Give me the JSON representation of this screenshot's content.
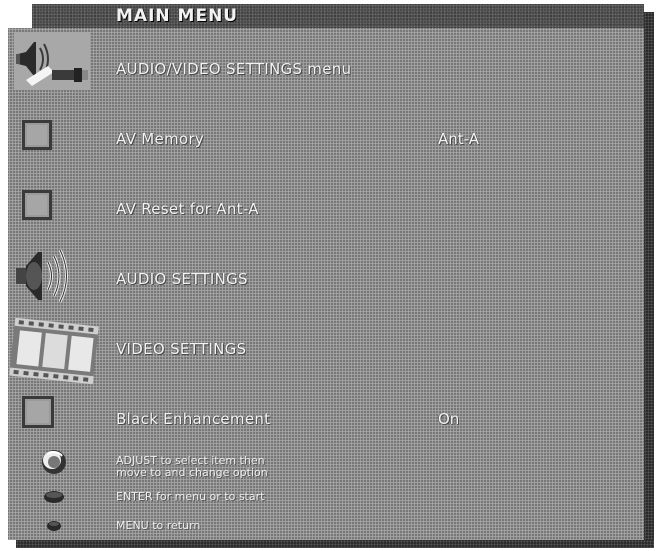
{
  "menu": {
    "title": "MAIN MENU",
    "items": [
      {
        "label": "AUDIO/VIDEO SETTINGS menu",
        "value": "",
        "icon": "av-settings-icon"
      },
      {
        "label": "AV Memory",
        "value": "Ant-A",
        "icon": "checkbox-icon"
      },
      {
        "label": "AV Reset for Ant-A",
        "value": "",
        "icon": "checkbox-icon"
      },
      {
        "label": "AUDIO SETTINGS",
        "value": "",
        "icon": "speaker-icon"
      },
      {
        "label": "VIDEO SETTINGS",
        "value": "",
        "icon": "film-icon"
      },
      {
        "label": "Black Enhancement",
        "value": "On",
        "icon": "checkbox-icon"
      }
    ]
  },
  "help": {
    "adjust_line1": "ADJUST to select item then",
    "adjust_line2": "move to and change option",
    "enter": "ENTER for menu or to start",
    "menu": "MENU to return"
  },
  "colors": {
    "panel": "#8f8f8f",
    "title_band": "#4a4a4a",
    "shadow": "#2b2b2b",
    "text": "#f4f4f4"
  }
}
